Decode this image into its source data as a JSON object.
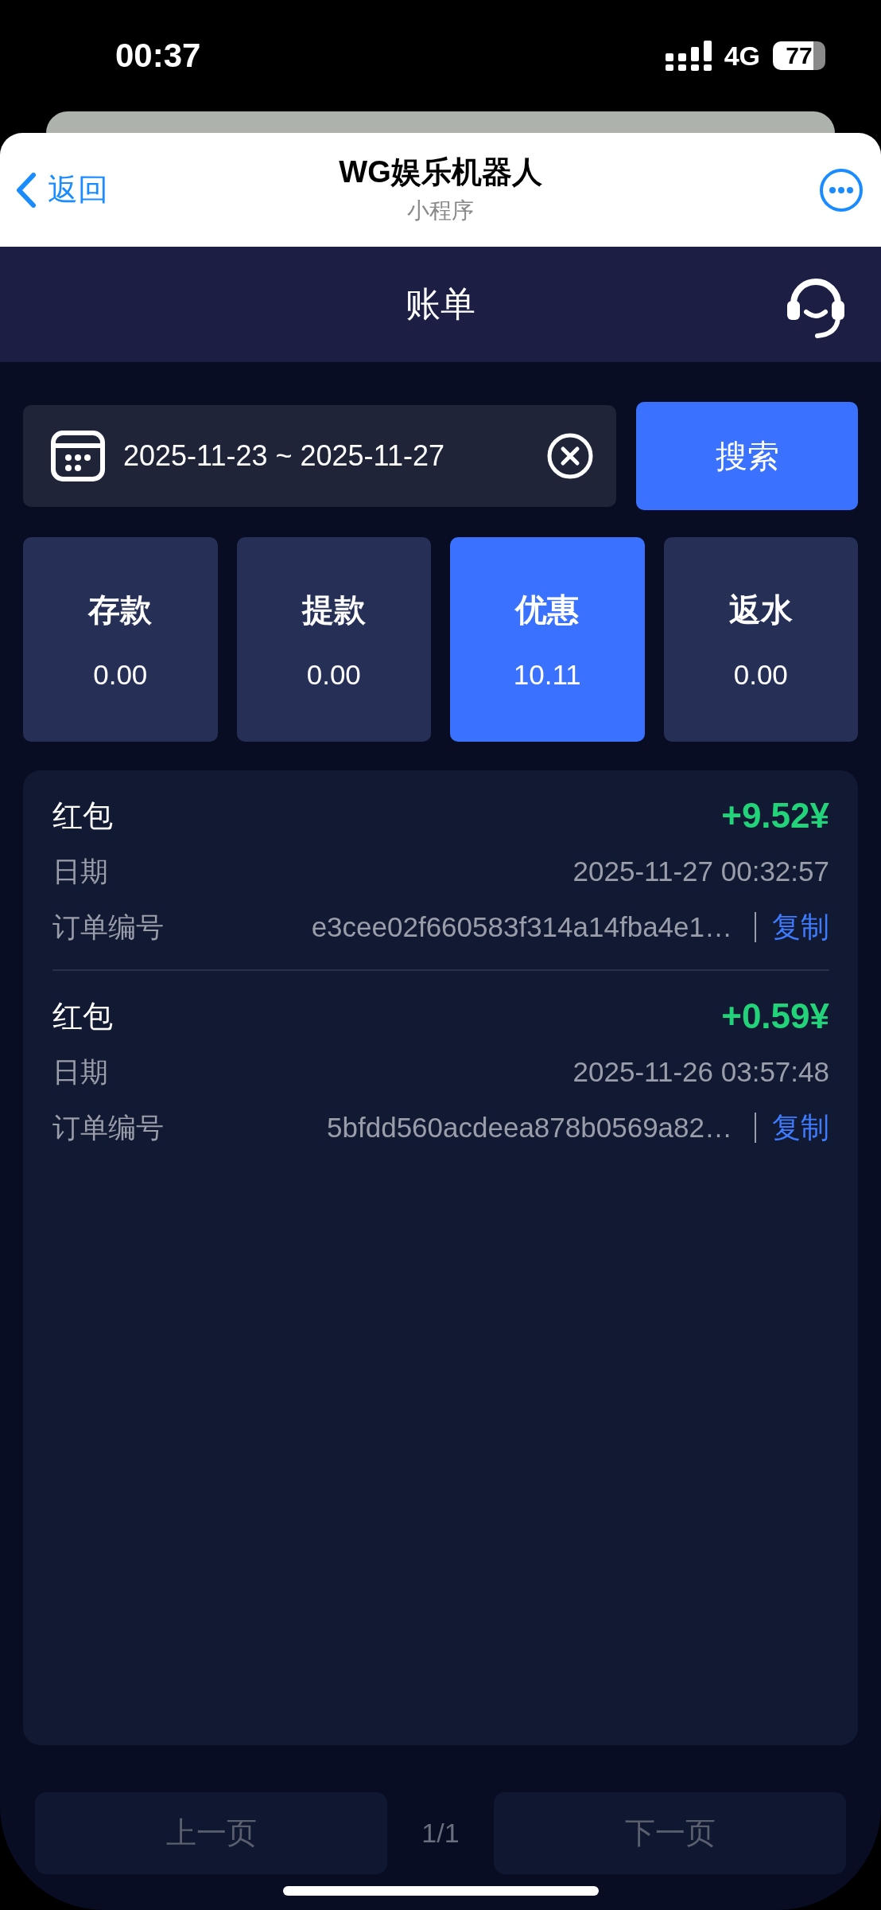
{
  "status_bar": {
    "time": "00:37",
    "network": "4G",
    "battery": "77"
  },
  "mini_program_bar": {
    "back": "返回",
    "title": "WG娱乐机器人",
    "subtitle": "小程序"
  },
  "header": {
    "title": "账单"
  },
  "filter": {
    "date_range": "2025-11-23 ~ 2025-11-27",
    "search_button": "搜索"
  },
  "tabs": [
    {
      "label": "存款",
      "amount": "0.00",
      "selected": false
    },
    {
      "label": "提款",
      "amount": "0.00",
      "selected": false
    },
    {
      "label": "优惠",
      "amount": "10.11",
      "selected": true
    },
    {
      "label": "返水",
      "amount": "0.00",
      "selected": false
    }
  ],
  "records": [
    {
      "type": "红包",
      "amount": "+9.52¥",
      "date_label": "日期",
      "date": "2025-11-27 00:32:57",
      "order_label": "订单编号",
      "order_no": "e3cee02f660583f314a14fba4e1…",
      "copy": "复制"
    },
    {
      "type": "红包",
      "amount": "+0.59¥",
      "date_label": "日期",
      "date": "2025-11-26 03:57:48",
      "order_label": "订单编号",
      "order_no": "5bfdd560acdeea878b0569a82…",
      "copy": "复制"
    }
  ],
  "pagination": {
    "prev": "上一页",
    "prev_disabled": true,
    "page": "1/1",
    "next": "下一页",
    "next_disabled": true
  }
}
